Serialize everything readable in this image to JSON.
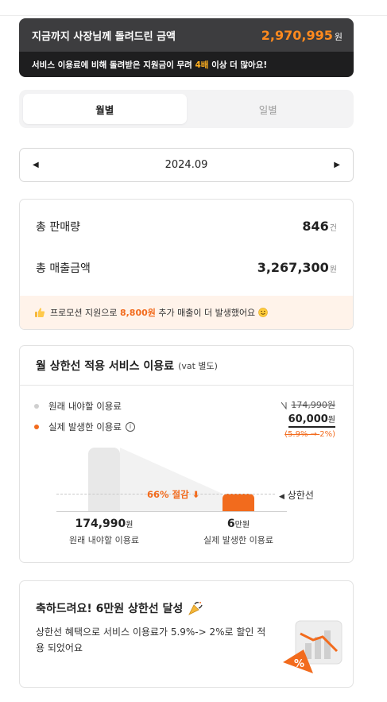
{
  "banner": {
    "title": "지금까지 사장님께 돌려드린 금액",
    "amount": "2,970,995",
    "amount_unit": "원",
    "message_prefix": "서비스 이용료에 비해 돌려받은 지원금이 무려 ",
    "message_highlight": "4배",
    "message_suffix": " 이상 더 많아요!"
  },
  "period_tabs": [
    {
      "label": "월별",
      "active": true
    },
    {
      "label": "일별",
      "active": false
    }
  ],
  "month_nav": {
    "label": "2024.09"
  },
  "sales": {
    "total_sales_label": "총 판매량",
    "total_sales_value": "846",
    "total_sales_unit": "건",
    "total_revenue_label": "총 매출금액",
    "total_revenue_value": "3,267,300",
    "total_revenue_unit": "원",
    "promo_prefix": "프로모션 지원으로 ",
    "promo_highlight": "8,800원",
    "promo_suffix": " 추가 매출이 더 발생했어요"
  },
  "fee_card": {
    "title": "월 상한선 적용 서비스 이용료",
    "title_sub": "(vat 별도)",
    "legend_original": "원래 내야할 이용료",
    "legend_actual": "실제 발생한 이용료",
    "price_old": "174,990원",
    "price_new": "60,000",
    "price_new_unit": "원",
    "rate_old": "(5.9%",
    "rate_arrow": " → ",
    "rate_new": "2%)",
    "savings_label": "66% 절감",
    "cap_label": "상한선",
    "original_value": "174,990",
    "original_unit": "원",
    "original_caption": "원래 내야할 이용료",
    "actual_value": "6",
    "actual_unit": "만원",
    "actual_caption": "실제 발생한 이용료"
  },
  "congrats": {
    "title": "축하드려요! 6만원 상한선 달성",
    "body": "상한선 혜택으로 서비스 이용료가 5.9%-> 2%로 할인 적용 되었어요"
  },
  "colors": {
    "accent": "#f26b1d",
    "banner_dark": "#1e1e1f",
    "banner_mid": "#3d3d3f",
    "highlight_yellow": "#ffb020"
  }
}
